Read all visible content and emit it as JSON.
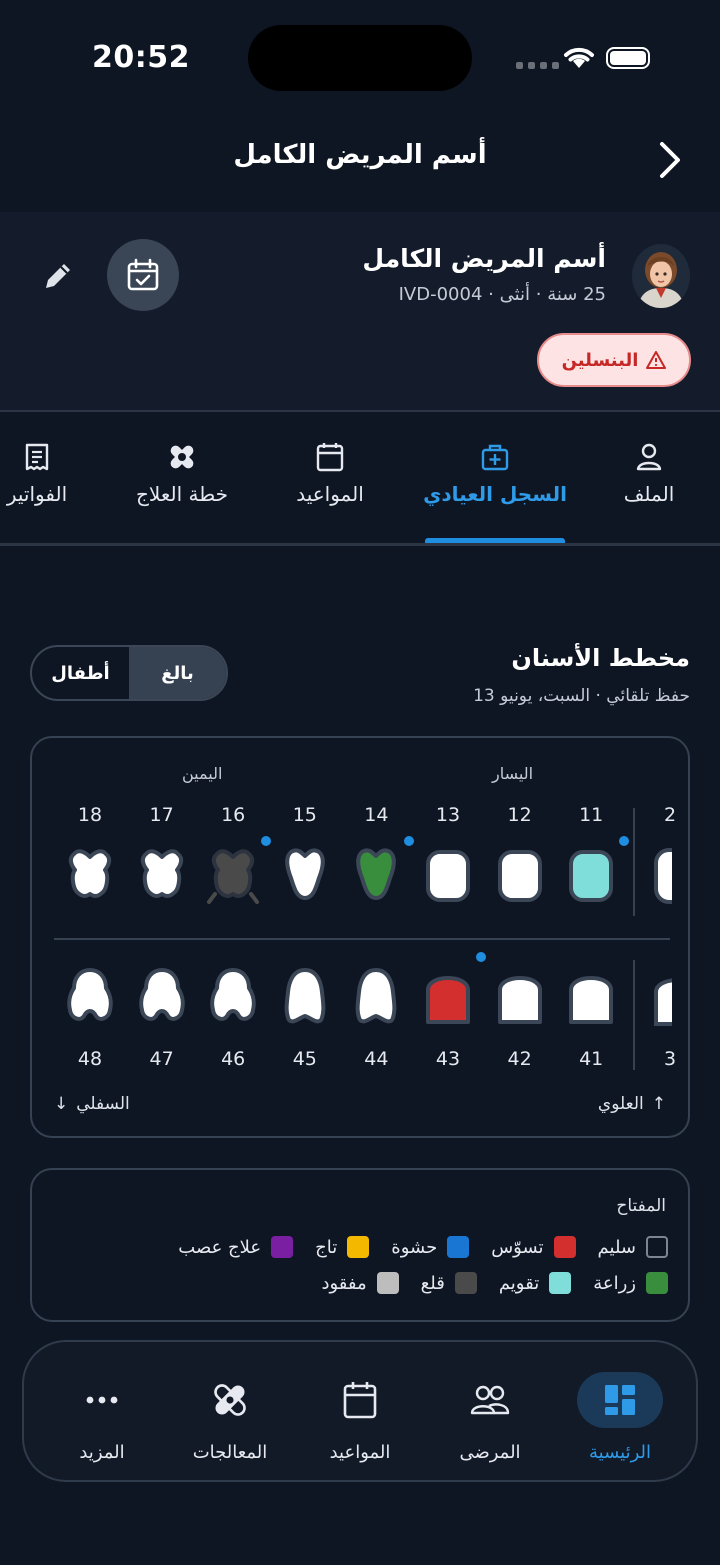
{
  "status_bar": {
    "time": "20:52"
  },
  "header": {
    "title": "أسم المريض الكامل"
  },
  "patient": {
    "name": "أسم المريض الكامل",
    "meta": "25 سنة · أنثى · IVD-0004",
    "allergy": "البنسلين"
  },
  "tabs": [
    {
      "label": "الملف",
      "icon": "person-icon"
    },
    {
      "label": "السجل العيادي",
      "icon": "medical-bag-icon",
      "active": true
    },
    {
      "label": "المواعيد",
      "icon": "calendar-icon"
    },
    {
      "label": "خطة العلاج",
      "icon": "bandage-icon"
    },
    {
      "label": "الفواتير",
      "icon": "receipt-icon"
    }
  ],
  "dental_chart": {
    "title": "مخطط الأسنان",
    "subtitle": "حفظ تلقائي · السبت، يونيو 13",
    "segment": {
      "adult": "بالغ",
      "child": "أطفال",
      "selected": "adult"
    },
    "side_left": "اليسار",
    "side_right": "اليمين",
    "upper_label": "العلوي",
    "lower_label": "السفلي",
    "upper_teeth": [
      {
        "number": "18",
        "state": "healthy",
        "shape": "molar"
      },
      {
        "number": "17",
        "state": "healthy",
        "shape": "molar"
      },
      {
        "number": "16",
        "state": "extraction",
        "shape": "molar",
        "marked": true
      },
      {
        "number": "15",
        "state": "healthy",
        "shape": "premolar"
      },
      {
        "number": "14",
        "state": "implant",
        "shape": "premolar",
        "marked": true
      },
      {
        "number": "13",
        "state": "healthy",
        "shape": "incisor"
      },
      {
        "number": "12",
        "state": "healthy",
        "shape": "incisor"
      },
      {
        "number": "11",
        "state": "orthodontic",
        "shape": "incisor",
        "marked": true
      }
    ],
    "lower_teeth": [
      {
        "number": "48",
        "state": "healthy",
        "shape": "molar"
      },
      {
        "number": "47",
        "state": "healthy",
        "shape": "molar"
      },
      {
        "number": "46",
        "state": "healthy",
        "shape": "molar"
      },
      {
        "number": "45",
        "state": "healthy",
        "shape": "premolar"
      },
      {
        "number": "44",
        "state": "healthy",
        "shape": "premolar"
      },
      {
        "number": "43",
        "state": "caries",
        "shape": "incisor",
        "marked": true
      },
      {
        "number": "42",
        "state": "healthy",
        "shape": "incisor"
      },
      {
        "number": "41",
        "state": "healthy",
        "shape": "incisor"
      }
    ],
    "upper_partial_number": "2",
    "lower_partial_number": "3"
  },
  "legend": {
    "title": "المفتاح",
    "items": [
      {
        "key": "healthy",
        "label": "سليم",
        "color": "#0f1623"
      },
      {
        "key": "caries",
        "label": "تسوّس",
        "color": "#d32f2f"
      },
      {
        "key": "filling",
        "label": "حشوة",
        "color": "#1976d2"
      },
      {
        "key": "crown",
        "label": "تاج",
        "color": "#f5b800"
      },
      {
        "key": "root_canal",
        "label": "علاج عصب",
        "color": "#7b1fa2"
      },
      {
        "key": "implant",
        "label": "زراعة",
        "color": "#388e3c"
      },
      {
        "key": "orthodontic",
        "label": "تقويم",
        "color": "#80deda"
      },
      {
        "key": "extraction",
        "label": "قلع",
        "color": "#4a4a4a"
      },
      {
        "key": "missing",
        "label": "مفقود",
        "color": "#bdbdbd"
      }
    ]
  },
  "bottom_nav": [
    {
      "label": "الرئيسية",
      "icon": "dashboard-icon",
      "active": true
    },
    {
      "label": "المرضى",
      "icon": "people-icon"
    },
    {
      "label": "المواعيد",
      "icon": "calendar-icon"
    },
    {
      "label": "المعالجات",
      "icon": "bandage-icon"
    },
    {
      "label": "المزيد",
      "icon": "more-icon"
    }
  ],
  "colors": {
    "accent": "#2f9be8",
    "background": "#0f1623",
    "marker": "#1f8de0"
  }
}
